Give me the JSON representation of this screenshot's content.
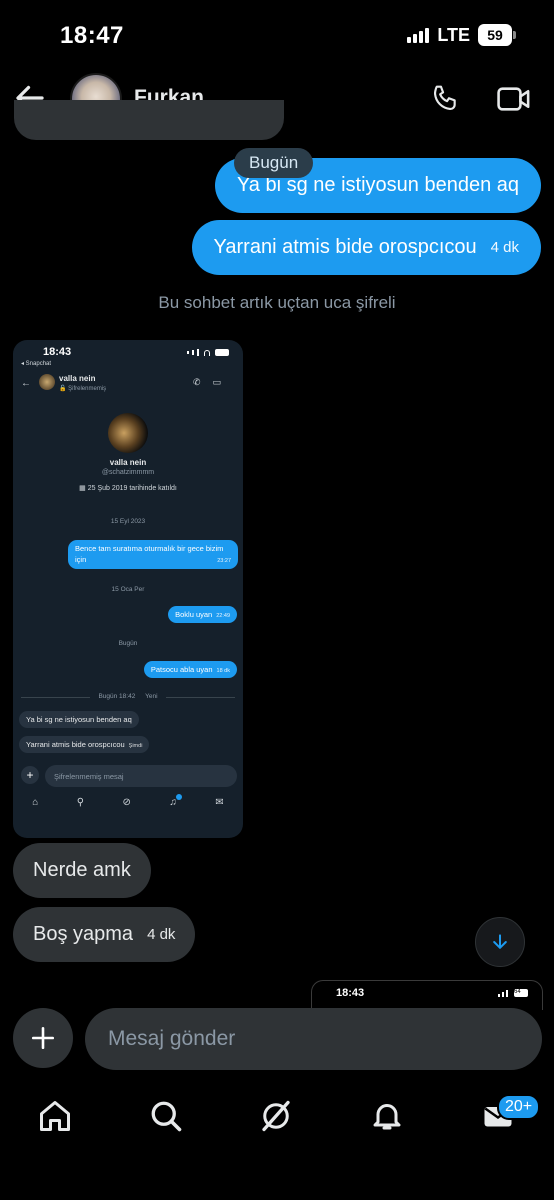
{
  "status_bar": {
    "time": "18:47",
    "network": "LTE",
    "battery": "59"
  },
  "header": {
    "name": "Furkan"
  },
  "conversation": {
    "date_pill": "Bugün",
    "outgoing": [
      {
        "text": "Ya bi sg ne istiyosun benden aq",
        "time": ""
      },
      {
        "text": "Yarrani atmis bide orospcıcou",
        "time": "4 dk"
      }
    ],
    "encrypted_note": "Bu sohbet artık uçtan uca şifreli",
    "incoming": [
      {
        "text": "Nerde amk",
        "time": ""
      },
      {
        "text": "Boş yapma",
        "time": "4 dk"
      }
    ]
  },
  "shared_screenshot": {
    "time": "18:43",
    "back_label": "◂ Snapchat",
    "chat_name": "valla nein",
    "chat_sub": "Şifrelenmemiş",
    "profile_name": "valla nein",
    "handle": "@schatzimmmm",
    "joined": "25 Şub 2019 tarihinde katıldı",
    "dates": [
      "15 Eyl 2023",
      "15 Oca Per",
      "Bugün"
    ],
    "outgoing": [
      {
        "text": "Bence tam suratıma oturmalık bir gece bizim için",
        "time": "23:27"
      },
      {
        "text": "Boklu uyan",
        "time": "22:49"
      },
      {
        "text": "Patsocu abla uyan",
        "time": "18 dk"
      }
    ],
    "new_divider_date": "Bugün 18:42",
    "new_label": "Yeni",
    "incoming": [
      {
        "text": "Ya bi sg ne istiyosun benden aq",
        "time": ""
      },
      {
        "text": "Yarrani atmis bide orospcıcou",
        "time": "Şimdi"
      }
    ],
    "input_placeholder": "Şifrelenmemiş mesaj"
  },
  "second_screenshot": {
    "time": "18:43",
    "battery": "64"
  },
  "composer": {
    "placeholder": "Mesaj gönder"
  },
  "bottom_nav": {
    "messages_badge": "20+"
  },
  "colors": {
    "accent": "#1d9bf0",
    "bubble_in": "#2f3336",
    "background": "#000000"
  }
}
